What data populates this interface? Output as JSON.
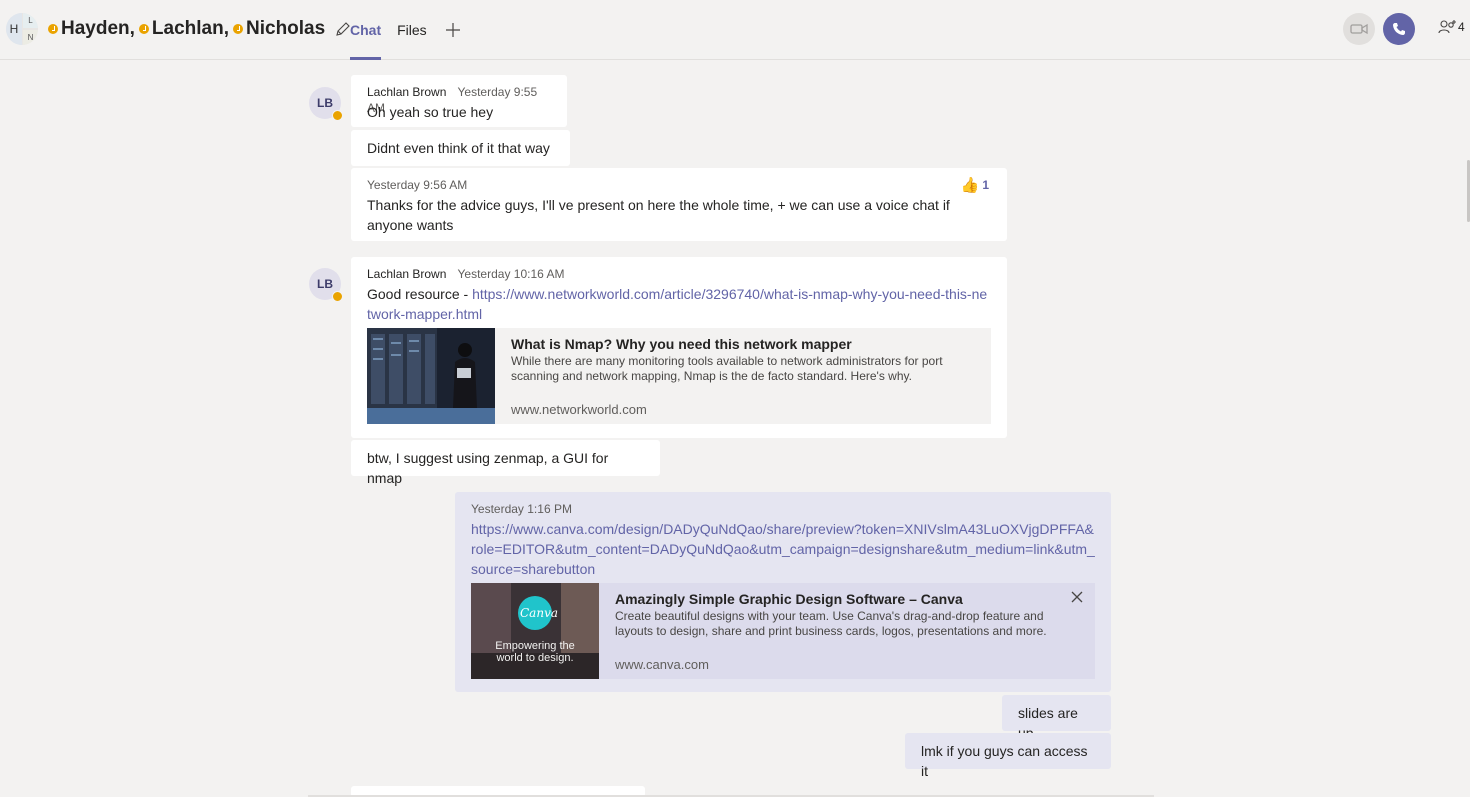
{
  "header": {
    "avatar_initials": {
      "main": "H",
      "top": "L",
      "bottom": "N"
    },
    "participants": [
      "Hayden,",
      "Lachlan,",
      "Nicholas"
    ],
    "tabs": [
      {
        "label": "Chat",
        "active": true
      },
      {
        "label": "Files",
        "active": false
      }
    ],
    "participant_count": "4",
    "accent_color": "#6264a7",
    "away_color": "#eaa300"
  },
  "messages": [
    {
      "initials": "LB",
      "author": "Lachlan Brown",
      "time": "Yesterday 9:55 AM",
      "text": "Oh yeah so true hey"
    },
    {
      "text": "Didnt even think of it that way"
    },
    {
      "time": "Yesterday 9:56 AM",
      "text": "Thanks for the advice guys, I'll ve present on here the whole time, + we can use a voice chat if anyone wants",
      "reaction": {
        "icon": "thumbs-up-icon",
        "count": "1"
      }
    },
    {
      "initials": "LB",
      "author": "Lachlan Brown",
      "time": "Yesterday 10:16 AM",
      "prefix": "Good resource - ",
      "link": "https://www.networkworld.com/article/3296740/what-is-nmap-why-you-need-this-network-mapper.html",
      "card": {
        "title": "What is Nmap? Why you need this network mapper",
        "description": "While there are many monitoring tools available to network administrators for port scanning and network mapping, Nmap is the de facto standard. Here's why.",
        "url": "www.networkworld.com"
      }
    },
    {
      "text": "btw, I suggest using zenmap, a GUI for nmap"
    },
    {
      "time": "Yesterday 1:16 PM",
      "link": "https://www.canva.com/design/DADyQuNdQao/share/preview?token=XNIVslmA43LuOXVjgDPFFA&role=EDITOR&utm_content=DADyQuNdQao&utm_campaign=designshare&utm_medium=link&utm_source=sharebutton",
      "card": {
        "title": "Amazingly Simple Graphic Design Software – Canva",
        "description": "Create beautiful designs with your team. Use Canva's drag-and-drop feature and layouts to design, share and print business cards, logos, presentations and more.",
        "url": "www.canva.com",
        "thumb_logo": "Canva",
        "thumb_caption": "Empowering the world to design."
      }
    },
    {
      "text": "slides are up"
    },
    {
      "text": "lmk if you guys can access it"
    }
  ]
}
